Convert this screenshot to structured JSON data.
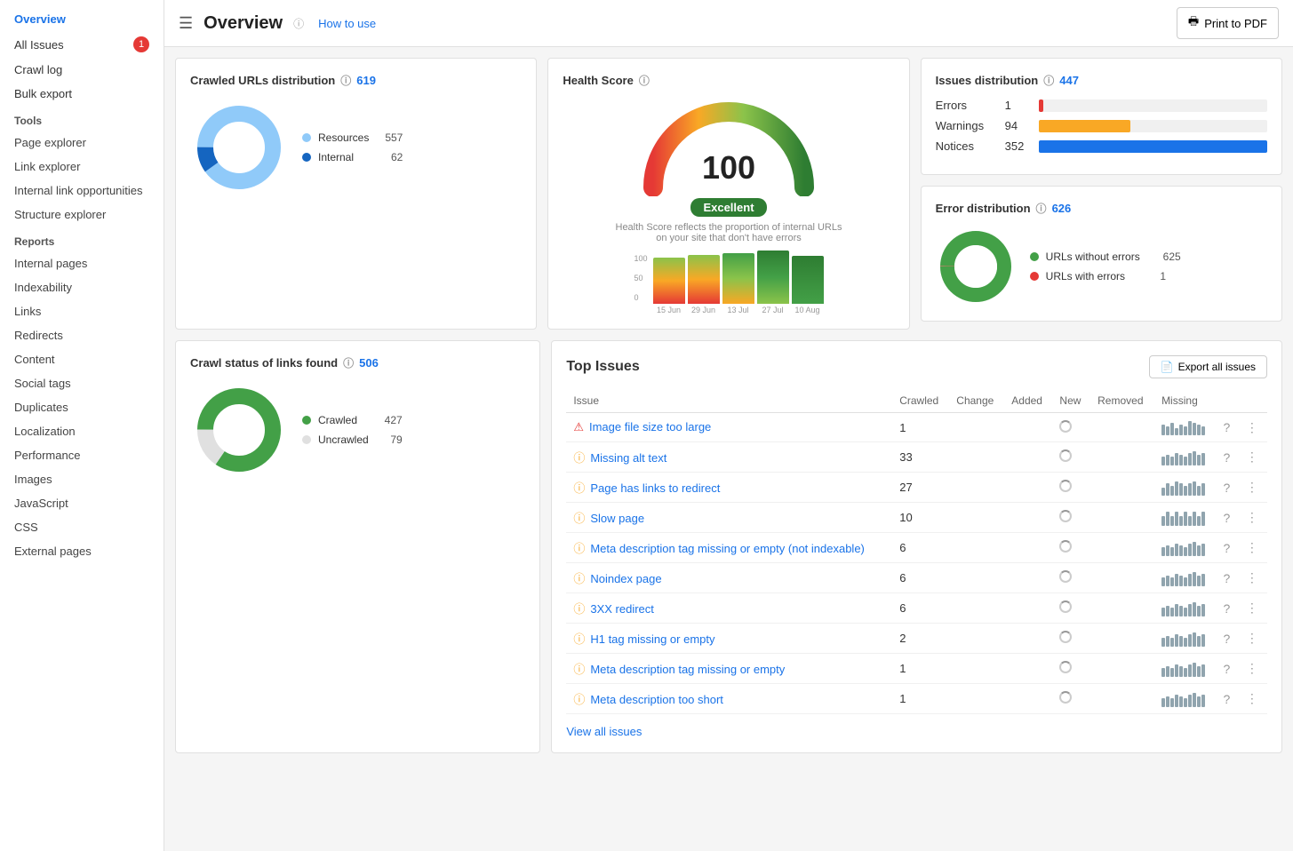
{
  "sidebar": {
    "items": [
      {
        "id": "overview",
        "label": "Overview",
        "active": true,
        "badge": null,
        "level": 0
      },
      {
        "id": "all-issues",
        "label": "All Issues",
        "active": false,
        "badge": "1",
        "level": 0
      },
      {
        "id": "crawl-log",
        "label": "Crawl log",
        "active": false,
        "badge": null,
        "level": 0
      },
      {
        "id": "bulk-export",
        "label": "Bulk export",
        "active": false,
        "badge": null,
        "level": 0
      }
    ],
    "sections": [
      {
        "label": "Tools",
        "items": [
          {
            "id": "page-explorer",
            "label": "Page explorer"
          },
          {
            "id": "link-explorer",
            "label": "Link explorer"
          },
          {
            "id": "internal-link-opp",
            "label": "Internal link opportunities"
          },
          {
            "id": "structure-explorer",
            "label": "Structure explorer"
          }
        ]
      },
      {
        "label": "Reports",
        "items": [
          {
            "id": "internal-pages",
            "label": "Internal pages"
          },
          {
            "id": "indexability",
            "label": "Indexability"
          },
          {
            "id": "links",
            "label": "Links"
          },
          {
            "id": "redirects",
            "label": "Redirects"
          },
          {
            "id": "content",
            "label": "Content"
          },
          {
            "id": "social-tags",
            "label": "Social tags"
          },
          {
            "id": "duplicates",
            "label": "Duplicates"
          },
          {
            "id": "localization",
            "label": "Localization"
          },
          {
            "id": "performance",
            "label": "Performance"
          },
          {
            "id": "images",
            "label": "Images"
          },
          {
            "id": "javascript",
            "label": "JavaScript"
          },
          {
            "id": "css",
            "label": "CSS"
          },
          {
            "id": "external-pages",
            "label": "External pages"
          }
        ]
      }
    ]
  },
  "header": {
    "title": "Overview",
    "how_to_use": "How to use",
    "print_button": "Print to PDF"
  },
  "crawled_urls": {
    "title": "Crawled URLs distribution",
    "total": "619",
    "resources": {
      "label": "Resources",
      "value": 557,
      "color": "#90caf9"
    },
    "internal": {
      "label": "Internal",
      "value": 62,
      "color": "#1565c0"
    }
  },
  "crawl_status": {
    "title": "Crawl status of links found",
    "total": "506",
    "crawled": {
      "label": "Crawled",
      "value": 427,
      "color": "#43a047"
    },
    "uncrawled": {
      "label": "Uncrawled",
      "value": 79,
      "color": "#e0e0e0"
    }
  },
  "health_score": {
    "title": "Health Score",
    "score": "100",
    "label": "Excellent",
    "subtitle": "Health Score reflects the proportion of internal URLs on your site that don't have errors",
    "chart": {
      "bars": [
        {
          "label": "15 Jun",
          "value": 85,
          "color_top": "#f9a825",
          "color_bottom": "#e53935"
        },
        {
          "label": "29 Jun",
          "value": 88,
          "color_top": "#f9a825",
          "color_bottom": "#e53935"
        },
        {
          "label": "13 Jul",
          "value": 90,
          "color_top": "#8bc34a",
          "color_bottom": "#f9a825"
        },
        {
          "label": "27 Jul",
          "value": 95,
          "color_top": "#43a047",
          "color_bottom": "#8bc34a"
        },
        {
          "label": "10 Aug",
          "value": 100,
          "color_top": "#2e7d32",
          "color_bottom": "#43a047"
        }
      ],
      "y_labels": [
        "100",
        "50",
        "0"
      ]
    }
  },
  "issues_distribution": {
    "title": "Issues distribution",
    "total": "447",
    "errors": {
      "label": "Errors",
      "value": 1,
      "bar_width": "2%",
      "color": "#e53935"
    },
    "warnings": {
      "label": "Warnings",
      "value": 94,
      "bar_width": "40%",
      "color": "#f9a825"
    },
    "notices": {
      "label": "Notices",
      "value": 352,
      "bar_width": "100%",
      "color": "#1a73e8"
    }
  },
  "error_distribution": {
    "title": "Error distribution",
    "total": "626",
    "without_errors": {
      "label": "URLs without errors",
      "value": 625,
      "color": "#43a047"
    },
    "with_errors": {
      "label": "URLs with errors",
      "value": 1,
      "color": "#e53935"
    }
  },
  "top_issues": {
    "title": "Top Issues",
    "export_label": "Export all issues",
    "view_all": "View all issues",
    "columns": [
      "Issue",
      "Crawled",
      "Change",
      "Added",
      "New",
      "Removed",
      "Missing"
    ],
    "rows": [
      {
        "icon": "error",
        "label": "Image file size too large",
        "crawled": 1,
        "change": "",
        "added": "",
        "new": true,
        "removed": "",
        "missing": "",
        "sparkbar": [
          6,
          5,
          7,
          4,
          6,
          5,
          8,
          7,
          6,
          5
        ]
      },
      {
        "icon": "warning",
        "label": "Missing alt text",
        "crawled": 33,
        "change": "",
        "added": "",
        "new": true,
        "removed": "",
        "missing": "",
        "sparkbar": [
          5,
          6,
          5,
          7,
          6,
          5,
          7,
          8,
          6,
          7
        ]
      },
      {
        "icon": "warning",
        "label": "Page has links to redirect",
        "crawled": 27,
        "change": "",
        "added": "",
        "new": true,
        "removed": "",
        "missing": "",
        "sparkbar": [
          4,
          6,
          5,
          7,
          6,
          5,
          6,
          7,
          5,
          6
        ]
      },
      {
        "icon": "warning",
        "label": "Slow page",
        "crawled": 10,
        "change": "",
        "added": "",
        "new": true,
        "removed": "",
        "missing": "",
        "sparkbar": [
          2,
          3,
          2,
          3,
          2,
          3,
          2,
          3,
          2,
          3
        ]
      },
      {
        "icon": "warning",
        "label": "Meta description tag missing or empty (not indexable)",
        "crawled": 6,
        "change": "",
        "added": "",
        "new": true,
        "removed": "",
        "missing": "",
        "sparkbar": [
          5,
          6,
          5,
          7,
          6,
          5,
          7,
          8,
          6,
          7
        ]
      },
      {
        "icon": "warning",
        "label": "Noindex page",
        "crawled": 6,
        "change": "",
        "added": "",
        "new": true,
        "removed": "",
        "missing": "",
        "sparkbar": [
          5,
          6,
          5,
          7,
          6,
          5,
          7,
          8,
          6,
          7
        ]
      },
      {
        "icon": "warning",
        "label": "3XX redirect",
        "crawled": 6,
        "change": "",
        "added": "",
        "new": true,
        "removed": "",
        "missing": "",
        "sparkbar": [
          5,
          6,
          5,
          7,
          6,
          5,
          7,
          8,
          6,
          7
        ]
      },
      {
        "icon": "warning",
        "label": "H1 tag missing or empty",
        "crawled": 2,
        "change": "",
        "added": "",
        "new": true,
        "removed": "",
        "missing": "",
        "sparkbar": [
          5,
          6,
          5,
          7,
          6,
          5,
          7,
          8,
          6,
          7
        ]
      },
      {
        "icon": "warning",
        "label": "Meta description tag missing or empty",
        "crawled": 1,
        "change": "",
        "added": "",
        "new": true,
        "removed": "",
        "missing": "",
        "sparkbar": [
          5,
          6,
          5,
          7,
          6,
          5,
          7,
          8,
          6,
          7
        ]
      },
      {
        "icon": "warning",
        "label": "Meta description too short",
        "crawled": 1,
        "change": "",
        "added": "",
        "new": true,
        "removed": "",
        "missing": "",
        "sparkbar": [
          5,
          6,
          5,
          7,
          6,
          5,
          7,
          8,
          6,
          7
        ]
      }
    ]
  }
}
